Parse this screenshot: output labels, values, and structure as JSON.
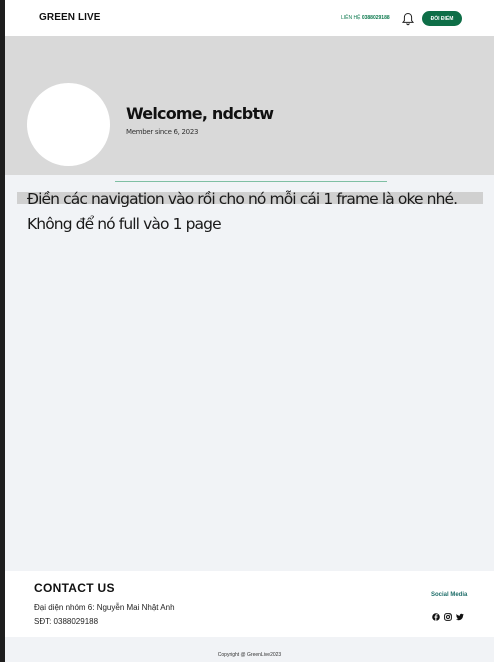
{
  "header": {
    "brand": "GREEN LIVE",
    "contact_label": "LIÊN HỆ",
    "contact_phone": "0388029188",
    "bell_icon": "bell-icon",
    "points_button": "ĐỔI ĐIỂM",
    "accent_color": "#0e6e47"
  },
  "profile": {
    "welcome": "Welcome, ndcbtw",
    "member_since": "Member since 6, 2023"
  },
  "note": {
    "line1": "Điền các navigation vào rồi cho nó mỗi cái 1 frame là oke nhé.",
    "line2": "Không để nó full vào 1 page"
  },
  "footer": {
    "contact_title": "CONTACT US",
    "address": "Đại diện nhóm 6: Nguyễn Mai Nhật Anh",
    "phone": "SĐT: 0388029188",
    "social_title": "Social Media",
    "social_icons": [
      "facebook-icon",
      "instagram-icon",
      "twitter-icon"
    ],
    "copyright": "Copyright @ GreenLive2023"
  }
}
